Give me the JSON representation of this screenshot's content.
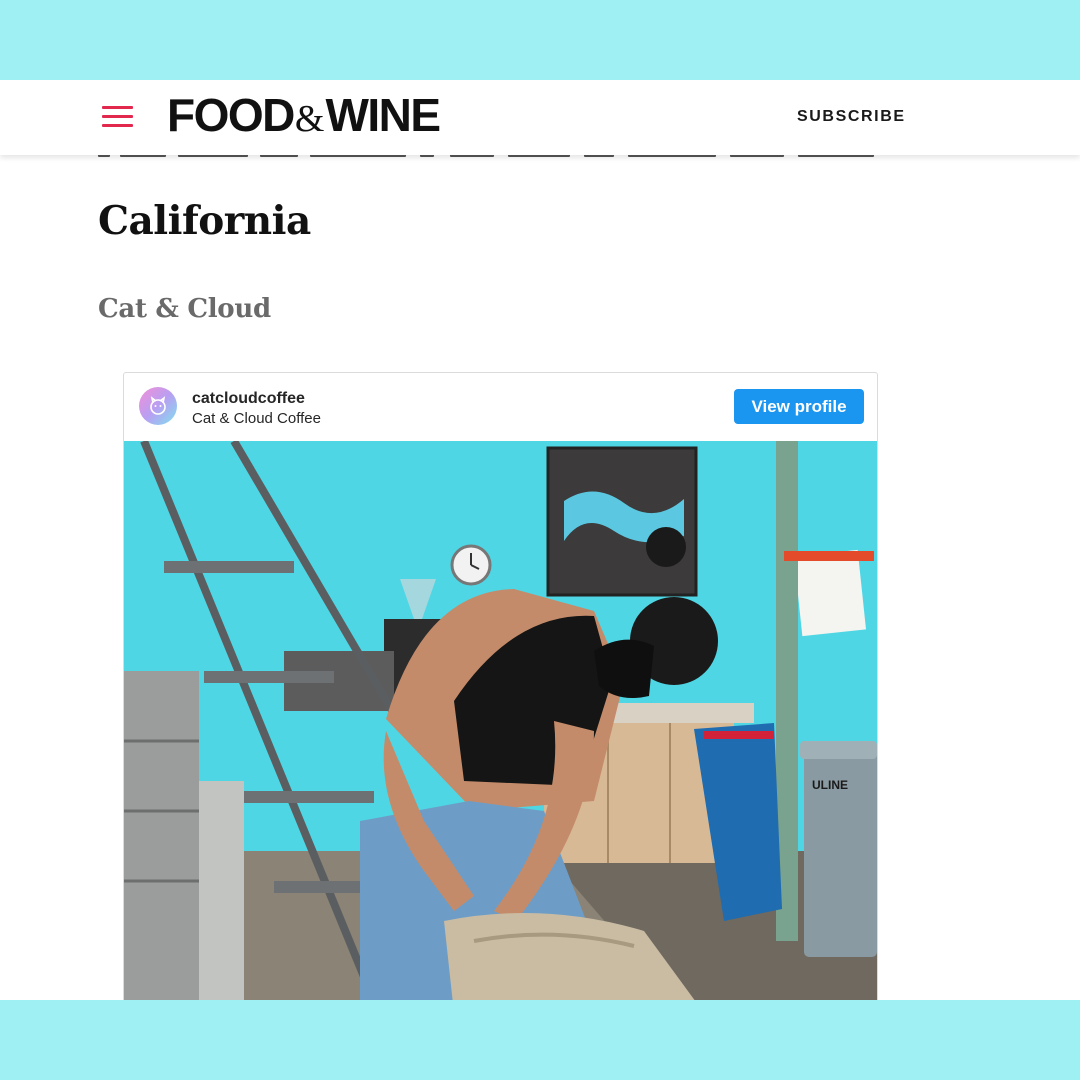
{
  "header": {
    "logo_left": "FOOD",
    "logo_amp": "&",
    "logo_right": "WINE",
    "subscribe_label": "SUBSCRIBE",
    "menu_icon": "hamburger-menu-icon"
  },
  "article": {
    "state_heading": "California",
    "shop_heading": "Cat & Cloud"
  },
  "instagram_embed": {
    "handle": "catcloudcoffee",
    "full_name": "Cat & Cloud Coffee",
    "view_profile_label": "View profile",
    "photo_label": "ULINE"
  },
  "colors": {
    "frame_background": "#9ff0f2",
    "menu_accent": "#e3284e",
    "button_blue": "#1a95f0",
    "wall_turquoise": "#4fd6e4"
  }
}
